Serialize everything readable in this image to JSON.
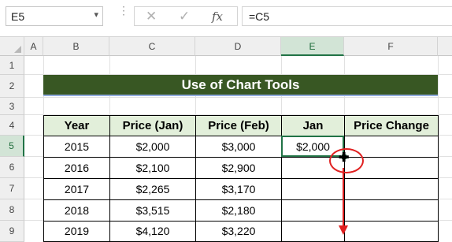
{
  "formula_bar": {
    "name_box": "E5",
    "name_box_dropdown": "▾",
    "cancel_icon": "✕",
    "enter_icon": "✓",
    "fx_label": "fx",
    "formula": "=C5"
  },
  "columns": [
    "A",
    "B",
    "C",
    "D",
    "E",
    "F"
  ],
  "rows": [
    "1",
    "2",
    "3",
    "4",
    "5",
    "6",
    "7",
    "8",
    "9"
  ],
  "sheet": {
    "title": "Use of Chart Tools",
    "headers": [
      "Year",
      "Price (Jan)",
      "Price (Feb)",
      "Jan",
      "Price Change"
    ],
    "data": [
      [
        "2015",
        "$2,000",
        "$3,000",
        "$2,000",
        ""
      ],
      [
        "2016",
        "$2,100",
        "$2,900",
        "",
        ""
      ],
      [
        "2017",
        "$2,265",
        "$3,170",
        "",
        ""
      ],
      [
        "2018",
        "$3,515",
        "$2,180",
        "",
        ""
      ],
      [
        "2019",
        "$4,120",
        "$3,220",
        "",
        ""
      ]
    ]
  },
  "selection": {
    "active_cell": "E5",
    "accent_color": "#217346",
    "annotation_color": "#e02020"
  },
  "colors": {
    "title_fill": "#385723",
    "header_fill": "#e2efda"
  }
}
